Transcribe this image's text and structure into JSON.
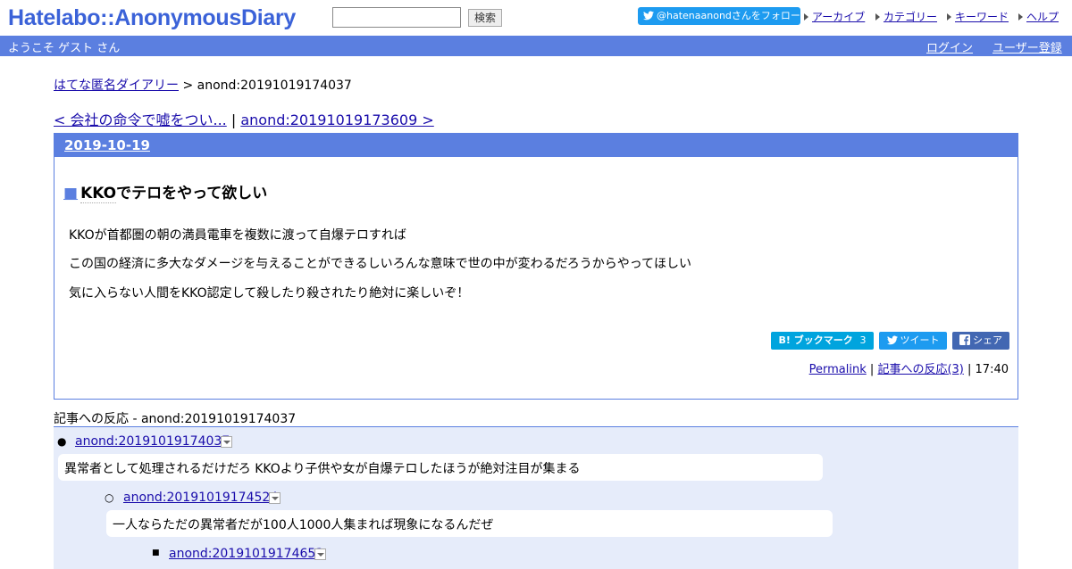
{
  "header": {
    "logo": "Hatelabo::AnonymousDiary",
    "search_placeholder": "",
    "search_button": "検索",
    "follow": "@hatenaanondさんをフォロー",
    "nav": [
      "アーカイブ",
      "カテゴリー",
      "キーワード",
      "ヘルプ"
    ]
  },
  "bar": {
    "welcome": "ようこそ ゲスト さん",
    "login": "ログイン",
    "register": "ユーザー登録"
  },
  "breadcrumb": {
    "home": "はてな匿名ダイアリー",
    "current": " > anond:20191019174037"
  },
  "pager": {
    "prev": "< 会社の命令で嘘をつい...",
    "sep": " | ",
    "next": "anond:20191019173609 >"
  },
  "entry": {
    "date": "2019-10-19",
    "title_mark": "■",
    "title_kw": "KKO",
    "title_rest": "でテロをやって欲しい",
    "lines": [
      "KKOが首都圏の朝の満員電車を複数に渡って自爆テロすれば",
      "この国の経済に多大なダメージを与えることができるしいろんな意味で世の中が変わるだろうからやってほしい",
      "気に入らない人間をKKO認定して殺したり殺されたり絶対に楽しいぞ！"
    ],
    "bookmark_label": "B! ブックマーク",
    "bookmark_count": "3",
    "tweet": "ツイート",
    "share": "シェア",
    "permalink": "Permalink",
    "reactions_link": "記事への反応(3)",
    "time": "17:40"
  },
  "reactions": {
    "title": "記事への反応 - anond:20191019174037",
    "items": [
      {
        "id": "anond:20191019174037",
        "text": "異常者として処理されるだけだろ KKOより子供や女が自爆テロしたほうが絶対注目が集まる"
      },
      {
        "id": "anond:20191019174524",
        "text": "一人ならただの異常者だが100人1000人集まれば現象になるんだぜ"
      },
      {
        "id": "anond:20191019174653",
        "text": ""
      }
    ]
  },
  "colors": {
    "brand": "#3b62d8",
    "bar": "#5b7fe0",
    "reaction_bg": "#e6ecfa",
    "hatebu": "#00a4de",
    "twitter": "#1d9bf0",
    "facebook": "#4267b2"
  }
}
